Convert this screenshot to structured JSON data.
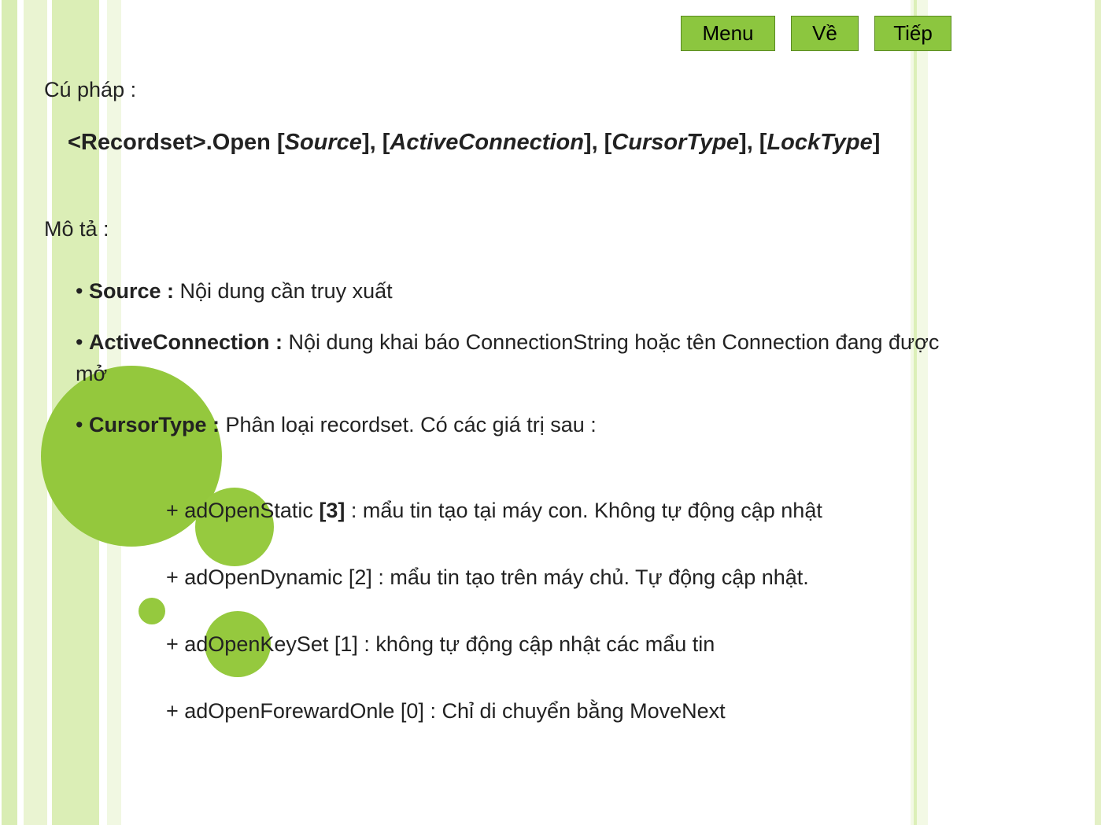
{
  "nav": {
    "menu": "Menu",
    "back": "Về",
    "next": "Tiếp"
  },
  "labels": {
    "syntax_header": "Cú pháp :",
    "desc_header": "Mô tả :"
  },
  "syntax": {
    "obj": "<Recordset>",
    "method": ".Open ",
    "p1": "Source",
    "p2": "ActiveConnection",
    "p3": "CursorType",
    "p4": "LockType"
  },
  "items": {
    "source": {
      "label": "Source : ",
      "text": "Nội dung cần truy xuất"
    },
    "active": {
      "label": "ActiveConnection : ",
      "text": "Nội dung khai báo ConnectionString hoặc tên Connection đang được mở"
    },
    "cursor": {
      "label": "CursorType : ",
      "text": "Phân loại recordset. Có các giá trị sau :"
    }
  },
  "cursor_values": {
    "r0_pre": "+ adOpenStatic ",
    "r0_num": "[3]",
    "r0_post": " : mẩu tin tạo tại máy con. Không tự động cập nhật",
    "r1": "+ adOpenDynamic [2] : mẩu tin tạo trên máy chủ. Tự động cập nhật.",
    "r2": "+ adOpenKeySet  [1] : không tự động cập nhật các mẩu tin",
    "r3": "+ adOpenForewardOnle [0] : Chỉ di chuyển bằng MoveNext"
  }
}
